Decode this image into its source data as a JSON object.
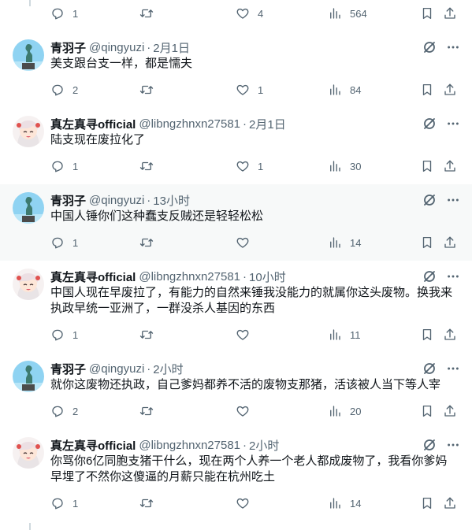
{
  "top_action_bar": {
    "reply": "1",
    "retweet": "",
    "like": "4",
    "views": "564"
  },
  "tweets": [
    {
      "name": "青羽子",
      "handle": "@qingyuzi",
      "time": "2月1日",
      "text": "美支跟台支一样，都是懦夫",
      "reply": "2",
      "retweet": "",
      "like": "1",
      "views": "84"
    },
    {
      "name": "真左真寻official",
      "handle": "@libngzhnxn27581",
      "time": "2月1日",
      "text": "陆支现在废拉化了",
      "reply": "1",
      "retweet": "",
      "like": "1",
      "views": "30"
    },
    {
      "name": "青羽子",
      "handle": "@qingyuzi",
      "time": "13小时",
      "text": "中国人锤你们这种蠢支反贼还是轻轻松松",
      "reply": "1",
      "retweet": "",
      "like": "",
      "views": "14"
    },
    {
      "name": "真左真寻official",
      "handle": "@libngzhnxn27581",
      "time": "10小时",
      "text_line1": "中国人现在早废拉了，有能力的自然来锤我没能力的就属你这头废物。换我来",
      "text_line2": "执政早统一亚洲了，一群没杀人基因的东西",
      "reply": "1",
      "retweet": "",
      "like": "",
      "views": "11"
    },
    {
      "name": "青羽子",
      "handle": "@qingyuzi",
      "time": "2小时",
      "text": "就你这废物还执政，自己爹妈都养不活的废物支那猪，活该被人当下等人宰",
      "reply": "2",
      "retweet": "",
      "like": "",
      "views": "20"
    },
    {
      "name": "真左真寻official",
      "handle": "@libngzhnxn27581",
      "time": "2小时",
      "text_line1": "你骂你6亿同胞支猪干什么，现在两个人养一个老人都成废物了，我看你爹妈",
      "text_line2": "早埋了不然你这傻逼的月薪只能在杭州吃土",
      "reply": "1",
      "retweet": "",
      "like": "",
      "views": "14"
    }
  ],
  "separator": "·",
  "colors": {
    "text": "#0f1419",
    "muted": "#536471",
    "highlight_bg": "#f7f9f9",
    "thread_line": "#cfd9de"
  }
}
